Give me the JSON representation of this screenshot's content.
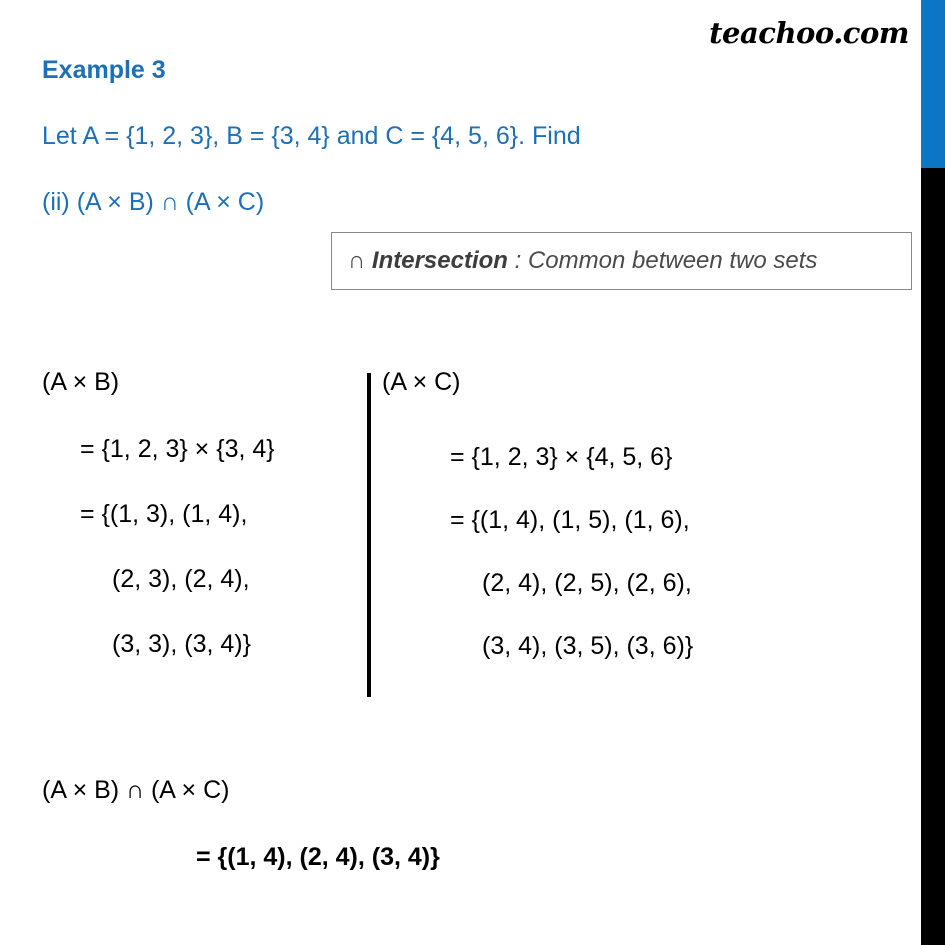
{
  "brand": {
    "label": "teachoo.com"
  },
  "header": {
    "example_title": "Example 3",
    "given": "Let A = {1, 2, 3}, B = {3, 4} and C = {4, 5, 6}. Find",
    "part": "(ii) (A × B) ∩ (A × C)"
  },
  "definition_box": {
    "symbol": "∩",
    "term": "Intersection",
    "separator": ":",
    "description": "Common between two sets",
    "border_color": "#8a8a8a",
    "text_color": "#4a4a4a"
  },
  "work": {
    "left_column": {
      "heading": "(A × B)",
      "lines": [
        "= {1, 2, 3} × {3, 4}",
        "= {(1, 3), (1, 4),",
        "(2, 3), (2, 4),",
        "(3, 3), (3, 4)}"
      ]
    },
    "right_column": {
      "heading": "(A × C)",
      "lines": [
        "= {1, 2, 3} ×  {4, 5, 6}",
        "= {(1, 4), (1, 5), (1, 6),",
        "(2, 4), (2, 5), (2, 6),",
        "(3, 4), (3, 5), (3, 6)}"
      ]
    }
  },
  "conclusion": {
    "expression": "(A × B) ∩ (A × C)",
    "answer": "= {(1, 4), (2, 4), (3, 4)}"
  },
  "theme": {
    "accent_blue": "#0C75C4",
    "heading_blue": "#1F6FB5",
    "sidebar_black": "#000000",
    "background": "#ffffff"
  }
}
